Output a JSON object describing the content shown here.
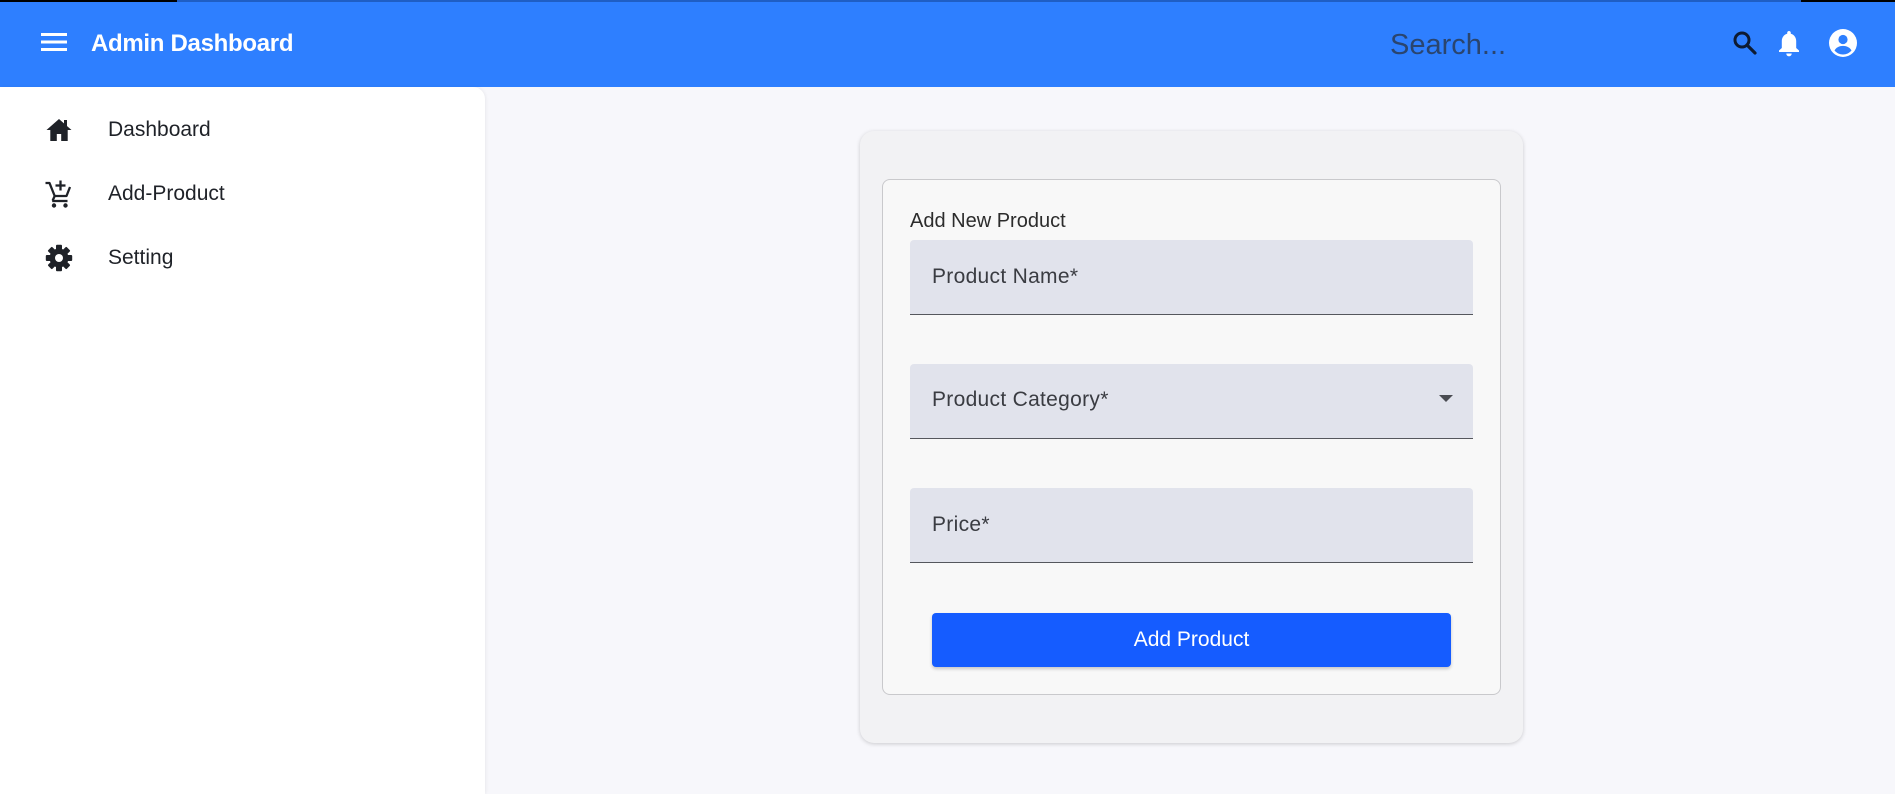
{
  "header": {
    "title": "Admin Dashboard",
    "search_placeholder": "Search...",
    "icons": [
      "menu-icon",
      "search-icon",
      "bell-icon",
      "account-circle-icon"
    ],
    "bar_color": "#2e7fff"
  },
  "sidebar": {
    "items": [
      {
        "label": "Dashboard",
        "icon": "home-icon"
      },
      {
        "label": "Add-Product",
        "icon": "add-shopping-cart-icon"
      },
      {
        "label": "Setting",
        "icon": "gear-icon"
      }
    ]
  },
  "form": {
    "title": "Add New Product",
    "product_name_placeholder": "Product Name*",
    "product_category_placeholder": "Product Category*",
    "price_placeholder": "Price*",
    "submit_label": "Add Product",
    "submit_color": "#155cff"
  }
}
